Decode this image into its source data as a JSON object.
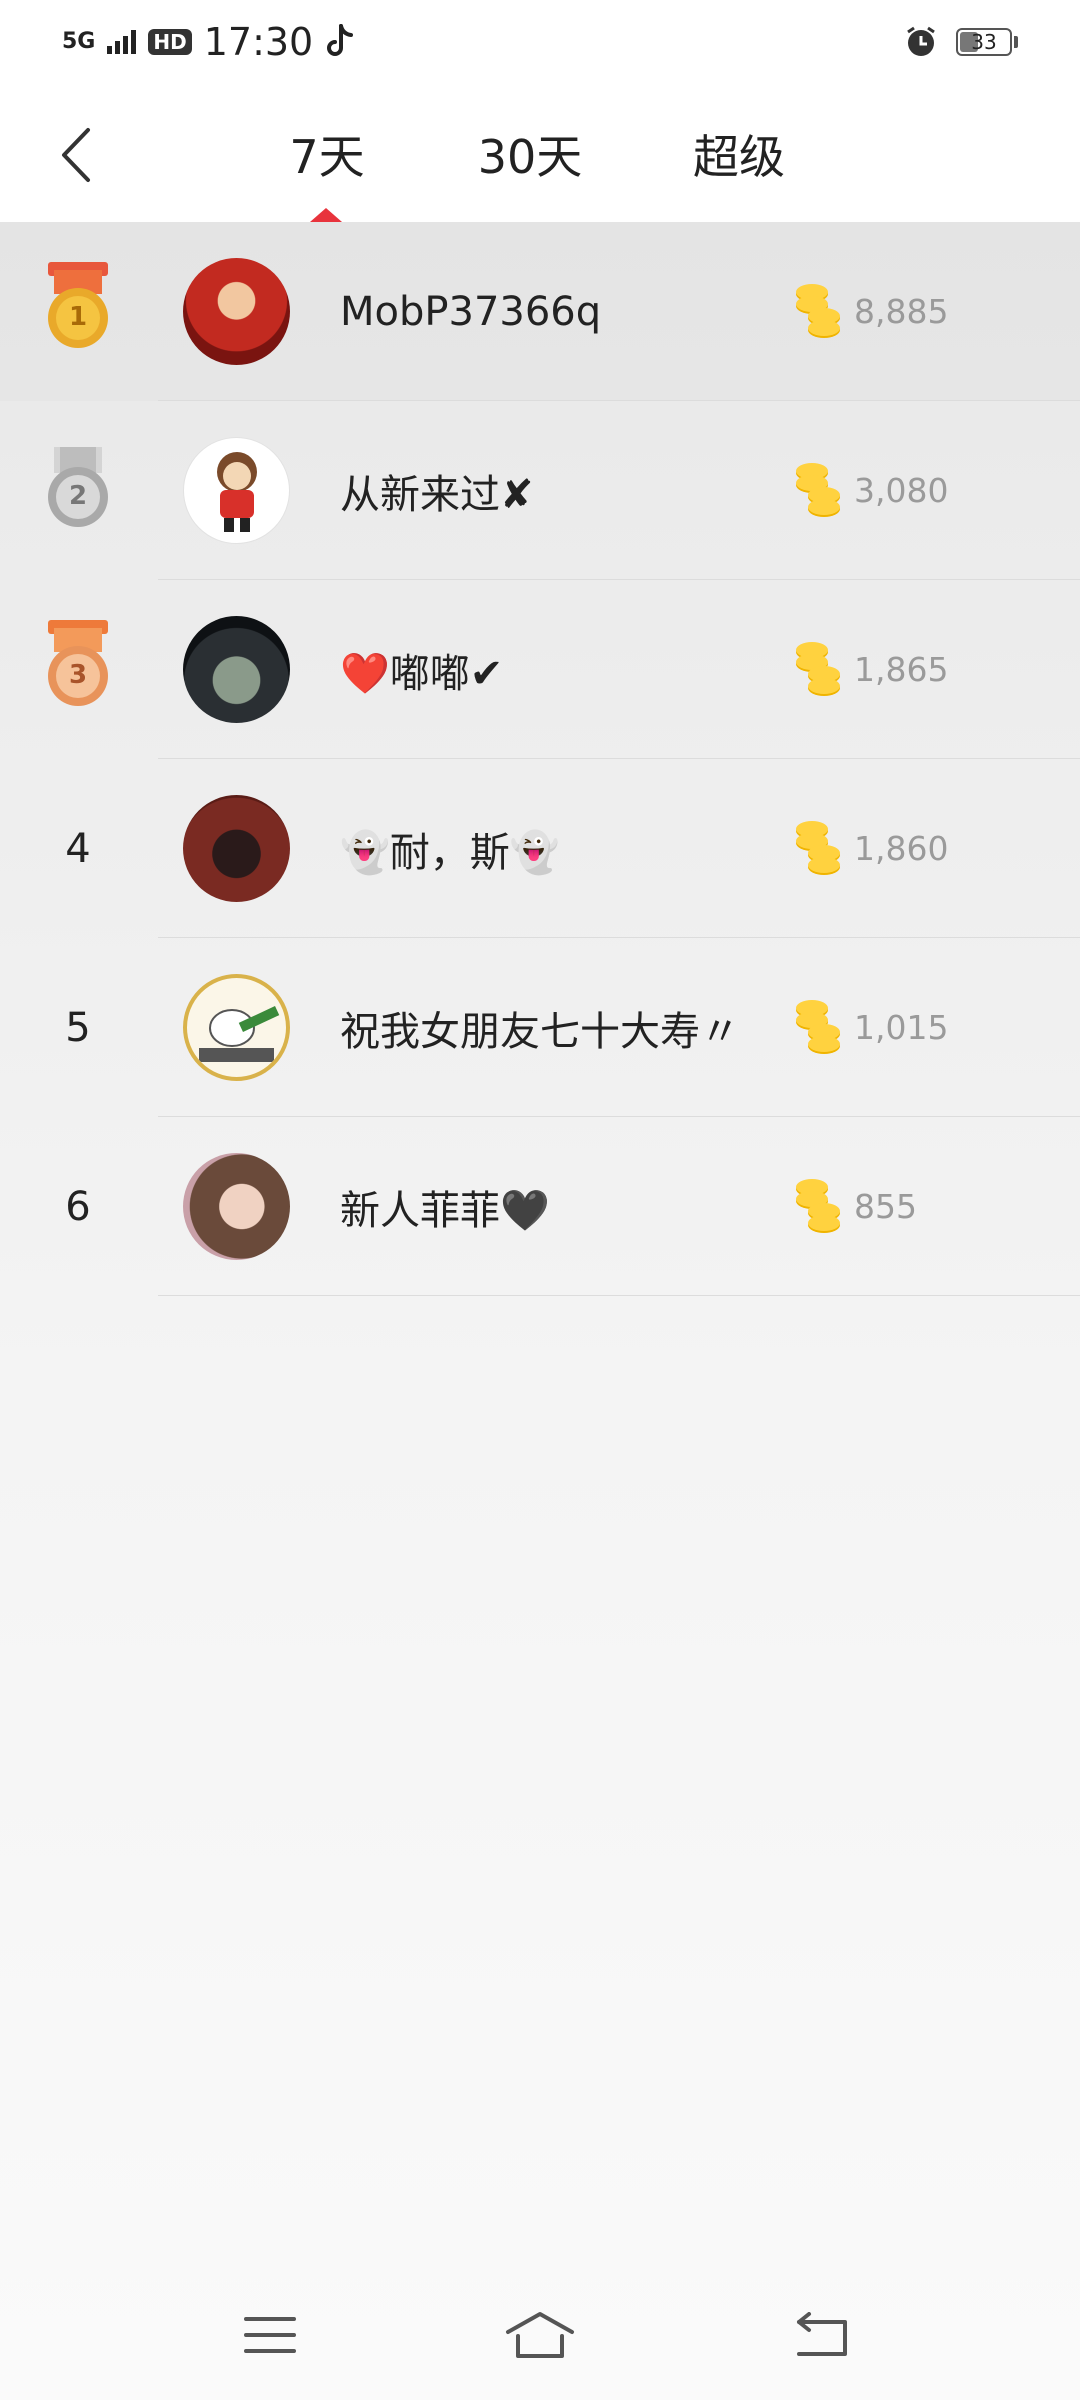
{
  "status_bar": {
    "network": "5G",
    "hd": "HD",
    "time": "17:30",
    "battery": "33"
  },
  "tabs": [
    {
      "label": "7天",
      "selected": true
    },
    {
      "label": "30天",
      "selected": false
    },
    {
      "label": "超级",
      "selected": false
    }
  ],
  "accent_color": "#e8333c",
  "ranking": [
    {
      "rank": "1",
      "medal": "gold",
      "name": "MobP37366q",
      "coins": "8,885"
    },
    {
      "rank": "2",
      "medal": "silver",
      "name": "从新来过✘",
      "coins": "3,080"
    },
    {
      "rank": "3",
      "medal": "bronze",
      "name": "❤️嘟嘟✔",
      "coins": "1,865"
    },
    {
      "rank": "4",
      "medal": "",
      "name": "👻耐，斯👻",
      "coins": "1,860"
    },
    {
      "rank": "5",
      "medal": "",
      "name": "祝我女朋友七十大寿〃",
      "coins": "1,015"
    },
    {
      "rank": "6",
      "medal": "",
      "name": "新人菲菲🖤",
      "coins": "855"
    }
  ],
  "icons": {
    "back": "chevron-left-icon",
    "coin": "coin-stack-icon",
    "nav_menu": "menu-icon",
    "nav_home": "home-icon",
    "nav_back": "back-icon"
  }
}
